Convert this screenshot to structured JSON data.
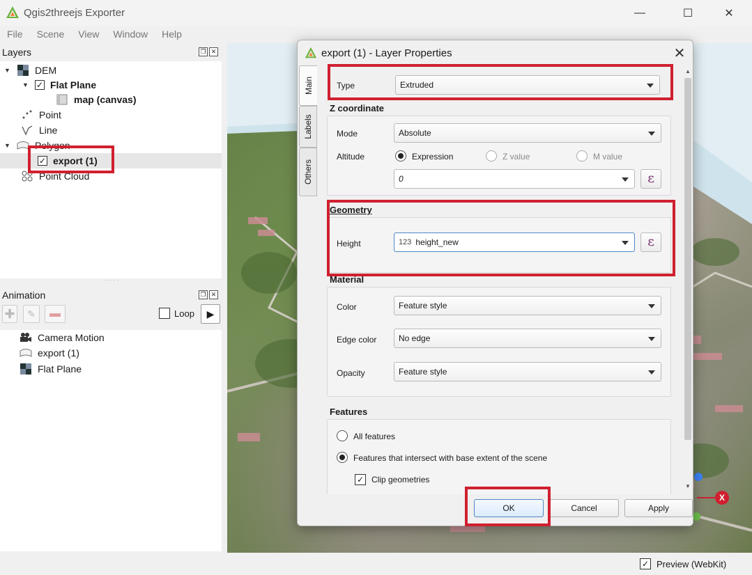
{
  "window": {
    "title": "Qgis2threejs Exporter",
    "minimize": "—",
    "maximize": "☐",
    "close": "✕"
  },
  "menu": [
    "File",
    "Scene",
    "View",
    "Window",
    "Help"
  ],
  "layers_panel": {
    "title": "Layers",
    "items": [
      {
        "label": "DEM"
      },
      {
        "label": "Flat Plane"
      },
      {
        "label": "map (canvas)"
      },
      {
        "label": "Point"
      },
      {
        "label": "Line"
      },
      {
        "label": "Polygon"
      },
      {
        "label": "export (1)"
      },
      {
        "label": "Point Cloud"
      }
    ]
  },
  "animation_panel": {
    "title": "Animation",
    "loop_label": "Loop",
    "items": [
      {
        "label": "Camera Motion"
      },
      {
        "label": "export (1)"
      },
      {
        "label": "Flat Plane"
      }
    ]
  },
  "statusbar": {
    "preview_label": "Preview (WebKit)"
  },
  "dialog": {
    "title": "export (1) - Layer Properties",
    "tabs": [
      "Main",
      "Labels",
      "Others"
    ],
    "type": {
      "label": "Type",
      "value": "Extruded"
    },
    "z_coordinate": {
      "title": "Z coordinate",
      "mode_label": "Mode",
      "mode_value": "Absolute",
      "altitude_label": "Altitude",
      "options": [
        "Expression",
        "Z value",
        "M value"
      ],
      "expression_value": "0"
    },
    "geometry": {
      "title": "Geometry",
      "height_label": "Height",
      "height_prefix": "123",
      "height_value": "height_new"
    },
    "material": {
      "title": "Material",
      "color_label": "Color",
      "color_value": "Feature style",
      "edge_label": "Edge color",
      "edge_value": "No edge",
      "opacity_label": "Opacity",
      "opacity_value": "Feature style"
    },
    "features": {
      "title": "Features",
      "all_label": "All features",
      "intersect_label": "Features that intersect with base extent of the scene",
      "clip_label": "Clip geometries"
    },
    "buttons": {
      "ok": "OK",
      "cancel": "Cancel",
      "apply": "Apply"
    },
    "epsilon": "ε"
  },
  "colors": {
    "highlight": "#cf2030",
    "accent": "#4f86c6",
    "epsilon": "#7a3570"
  }
}
